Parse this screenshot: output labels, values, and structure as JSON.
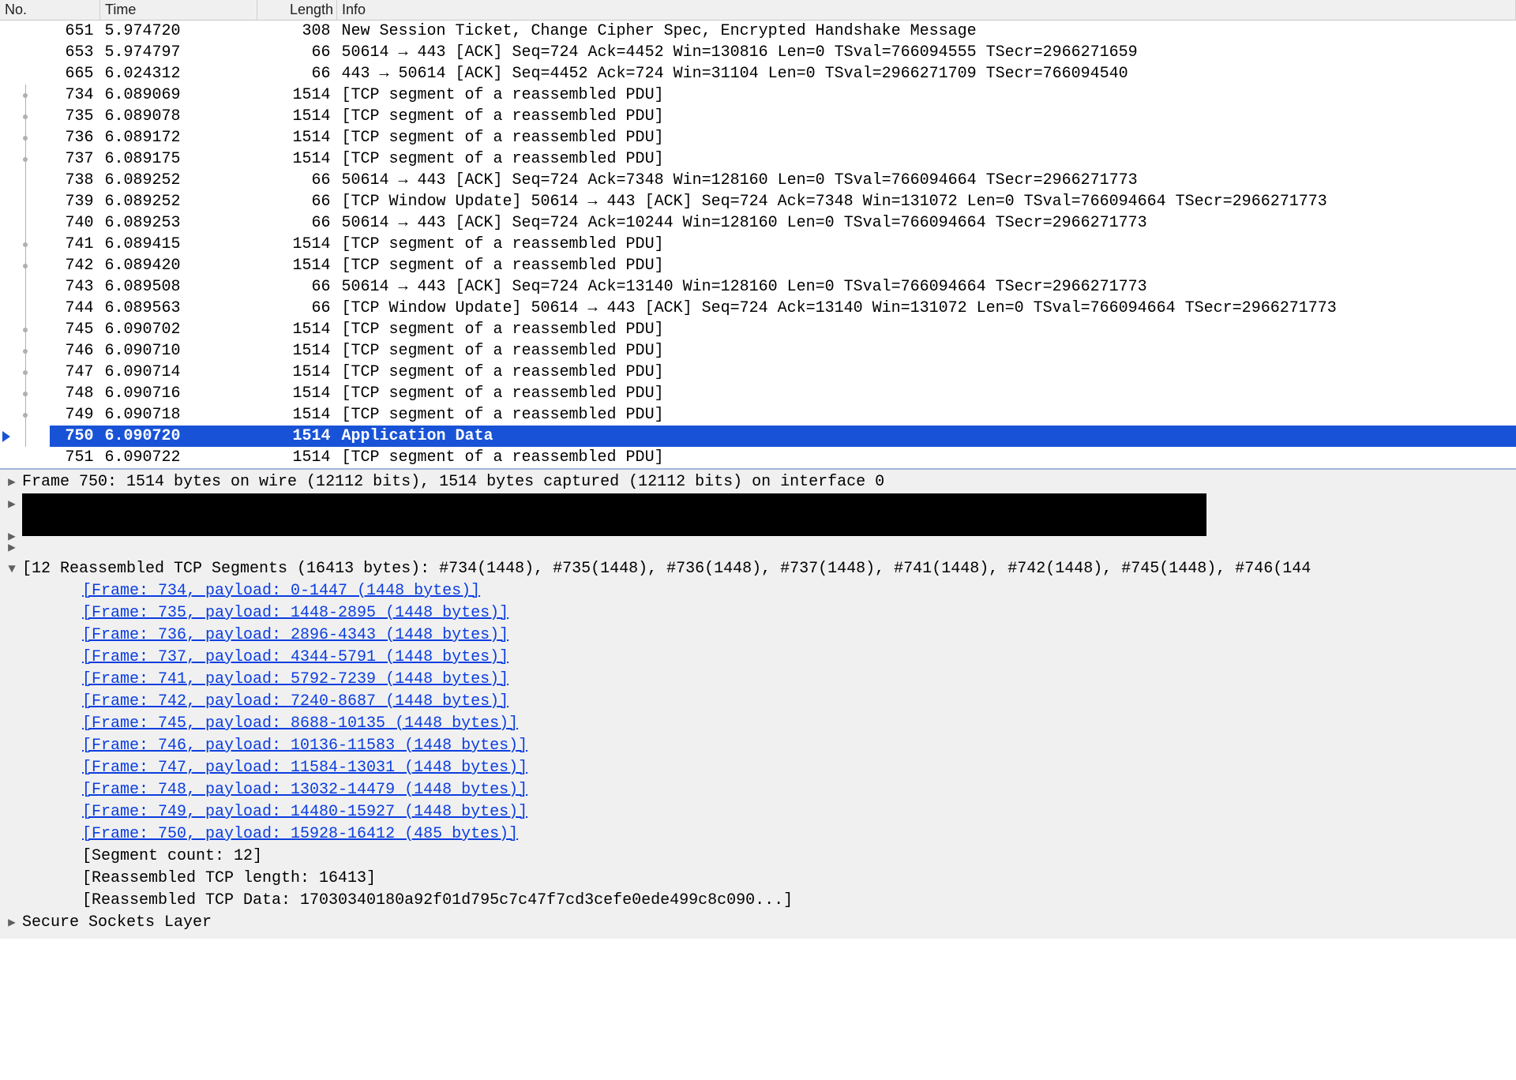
{
  "columns": {
    "no": "No.",
    "time": "Time",
    "length": "Length",
    "info": "Info"
  },
  "packets": [
    {
      "no": "651",
      "time": "5.974720",
      "length": "308",
      "info": "New Session Ticket, Change Cipher Spec, Encrypted Handshake Message",
      "gutter": "none"
    },
    {
      "no": "653",
      "time": "5.974797",
      "length": "66",
      "info": "50614 → 443 [ACK] Seq=724 Ack=4452 Win=130816 Len=0 TSval=766094555 TSecr=2966271659",
      "gutter": "none"
    },
    {
      "no": "665",
      "time": "6.024312",
      "length": "66",
      "info": "443 → 50614 [ACK] Seq=4452 Ack=724 Win=31104 Len=0 TSval=2966271709 TSecr=766094540",
      "gutter": "none"
    },
    {
      "no": "734",
      "time": "6.089069",
      "length": "1514",
      "info": "[TCP segment of a reassembled PDU]",
      "gutter": "dot"
    },
    {
      "no": "735",
      "time": "6.089078",
      "length": "1514",
      "info": "[TCP segment of a reassembled PDU]",
      "gutter": "dot"
    },
    {
      "no": "736",
      "time": "6.089172",
      "length": "1514",
      "info": "[TCP segment of a reassembled PDU]",
      "gutter": "dot"
    },
    {
      "no": "737",
      "time": "6.089175",
      "length": "1514",
      "info": "[TCP segment of a reassembled PDU]",
      "gutter": "dot"
    },
    {
      "no": "738",
      "time": "6.089252",
      "length": "66",
      "info": "50614 → 443 [ACK] Seq=724 Ack=7348 Win=128160 Len=0 TSval=766094664 TSecr=2966271773",
      "gutter": "line"
    },
    {
      "no": "739",
      "time": "6.089252",
      "length": "66",
      "info": "[TCP Window Update] 50614 → 443 [ACK] Seq=724 Ack=7348 Win=131072 Len=0 TSval=766094664 TSecr=2966271773",
      "gutter": "line"
    },
    {
      "no": "740",
      "time": "6.089253",
      "length": "66",
      "info": "50614 → 443 [ACK] Seq=724 Ack=10244 Win=128160 Len=0 TSval=766094664 TSecr=2966271773",
      "gutter": "line"
    },
    {
      "no": "741",
      "time": "6.089415",
      "length": "1514",
      "info": "[TCP segment of a reassembled PDU]",
      "gutter": "dot"
    },
    {
      "no": "742",
      "time": "6.089420",
      "length": "1514",
      "info": "[TCP segment of a reassembled PDU]",
      "gutter": "dot"
    },
    {
      "no": "743",
      "time": "6.089508",
      "length": "66",
      "info": "50614 → 443 [ACK] Seq=724 Ack=13140 Win=128160 Len=0 TSval=766094664 TSecr=2966271773",
      "gutter": "line"
    },
    {
      "no": "744",
      "time": "6.089563",
      "length": "66",
      "info": "[TCP Window Update] 50614 → 443 [ACK] Seq=724 Ack=13140 Win=131072 Len=0 TSval=766094664 TSecr=2966271773",
      "gutter": "line"
    },
    {
      "no": "745",
      "time": "6.090702",
      "length": "1514",
      "info": "[TCP segment of a reassembled PDU]",
      "gutter": "dot"
    },
    {
      "no": "746",
      "time": "6.090710",
      "length": "1514",
      "info": "[TCP segment of a reassembled PDU]",
      "gutter": "dot"
    },
    {
      "no": "747",
      "time": "6.090714",
      "length": "1514",
      "info": "[TCP segment of a reassembled PDU]",
      "gutter": "dot"
    },
    {
      "no": "748",
      "time": "6.090716",
      "length": "1514",
      "info": "[TCP segment of a reassembled PDU]",
      "gutter": "dot"
    },
    {
      "no": "749",
      "time": "6.090718",
      "length": "1514",
      "info": "[TCP segment of a reassembled PDU]",
      "gutter": "dot"
    },
    {
      "no": "750",
      "time": "6.090720",
      "length": "1514",
      "info": "Application Data",
      "gutter": "arrow",
      "selected": true
    },
    {
      "no": "751",
      "time": "6.090722",
      "length": "1514",
      "info": "[TCP segment of a reassembled PDU]",
      "gutter": "none"
    }
  ],
  "details": {
    "frame_line": "Frame 750: 1514 bytes on wire (12112 bits), 1514 bytes captured (12112 bits) on interface 0",
    "reassembly_header": "[12 Reassembled TCP Segments (16413 bytes): #734(1448), #735(1448), #736(1448), #737(1448), #741(1448), #742(1448), #745(1448), #746(144",
    "frame_links": [
      "[Frame: 734, payload: 0-1447 (1448 bytes)]",
      "[Frame: 735, payload: 1448-2895 (1448 bytes)]",
      "[Frame: 736, payload: 2896-4343 (1448 bytes)]",
      "[Frame: 737, payload: 4344-5791 (1448 bytes)]",
      "[Frame: 741, payload: 5792-7239 (1448 bytes)]",
      "[Frame: 742, payload: 7240-8687 (1448 bytes)]",
      "[Frame: 745, payload: 8688-10135 (1448 bytes)]",
      "[Frame: 746, payload: 10136-11583 (1448 bytes)]",
      "[Frame: 747, payload: 11584-13031 (1448 bytes)]",
      "[Frame: 748, payload: 13032-14479 (1448 bytes)]",
      "[Frame: 749, payload: 14480-15927 (1448 bytes)]",
      "[Frame: 750, payload: 15928-16412 (485 bytes)]"
    ],
    "segment_count": "[Segment count: 12]",
    "reassembled_len": "[Reassembled TCP length: 16413]",
    "reassembled_data": "[Reassembled TCP Data: 17030340180a92f01d795c7c47f7cd3cefe0ede499c8c090...]",
    "ssl_line": "Secure Sockets Layer"
  },
  "glyphs": {
    "closed": "▶",
    "open": "▼"
  }
}
